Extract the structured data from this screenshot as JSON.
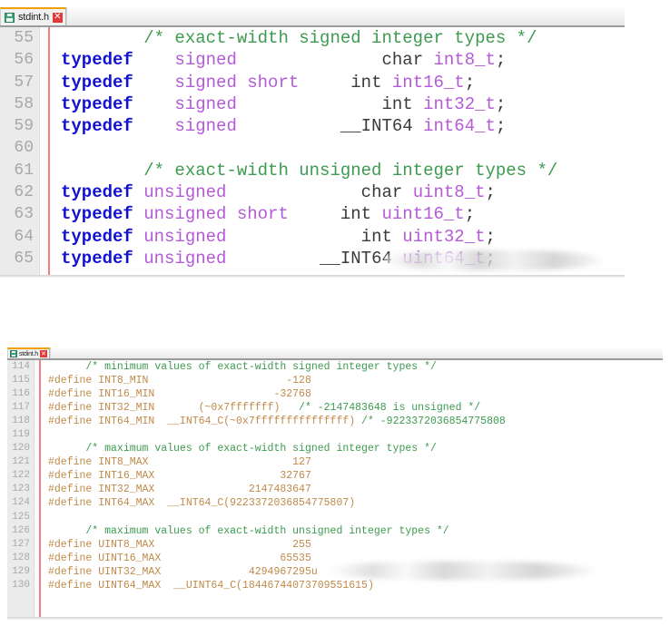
{
  "editors": [
    {
      "name": "editor-top",
      "tab": {
        "label": "stdint.h",
        "save_icon": "disk-icon",
        "close_icon": "close-icon",
        "close_glyph": "✕",
        "modified_accent": "#f0a000"
      },
      "first_line_number": 55,
      "line_numbers": [
        "55",
        "56",
        "57",
        "58",
        "59",
        "60",
        "61",
        "62",
        "63",
        "64",
        "65"
      ],
      "lines": [
        {
          "n": "55",
          "segments": [
            {
              "t": "com",
              "s": "        /* exact-width signed integer types */"
            }
          ]
        },
        {
          "n": "56",
          "segments": [
            {
              "t": "kw",
              "s": "typedef"
            },
            {
              "t": "typ",
              "s": "    signed"
            },
            {
              "t": "pln",
              "s": "              char "
            },
            {
              "t": "typ",
              "s": "int8_t"
            },
            {
              "t": "pln",
              "s": ";"
            }
          ]
        },
        {
          "n": "57",
          "segments": [
            {
              "t": "kw",
              "s": "typedef"
            },
            {
              "t": "typ",
              "s": "    signed short"
            },
            {
              "t": "pln",
              "s": "     int "
            },
            {
              "t": "typ",
              "s": "int16_t"
            },
            {
              "t": "pln",
              "s": ";"
            }
          ]
        },
        {
          "n": "58",
          "segments": [
            {
              "t": "kw",
              "s": "typedef"
            },
            {
              "t": "typ",
              "s": "    signed"
            },
            {
              "t": "pln",
              "s": "              int "
            },
            {
              "t": "typ",
              "s": "int32_t"
            },
            {
              "t": "pln",
              "s": ";"
            }
          ]
        },
        {
          "n": "59",
          "segments": [
            {
              "t": "kw",
              "s": "typedef"
            },
            {
              "t": "typ",
              "s": "    signed"
            },
            {
              "t": "pln",
              "s": "          __INT64 "
            },
            {
              "t": "typ",
              "s": "int64_t"
            },
            {
              "t": "pln",
              "s": ";"
            }
          ]
        },
        {
          "n": "60",
          "segments": [
            {
              "t": "pln",
              "s": ""
            }
          ]
        },
        {
          "n": "61",
          "segments": [
            {
              "t": "com",
              "s": "        /* exact-width unsigned integer types */"
            }
          ]
        },
        {
          "n": "62",
          "segments": [
            {
              "t": "kw",
              "s": "typedef"
            },
            {
              "t": "typ",
              "s": " unsigned"
            },
            {
              "t": "pln",
              "s": "             char "
            },
            {
              "t": "typ",
              "s": "uint8_t"
            },
            {
              "t": "pln",
              "s": ";"
            }
          ]
        },
        {
          "n": "63",
          "segments": [
            {
              "t": "kw",
              "s": "typedef"
            },
            {
              "t": "typ",
              "s": " unsigned short"
            },
            {
              "t": "pln",
              "s": "     int "
            },
            {
              "t": "typ",
              "s": "uint16_t"
            },
            {
              "t": "pln",
              "s": ";"
            }
          ]
        },
        {
          "n": "64",
          "segments": [
            {
              "t": "kw",
              "s": "typedef"
            },
            {
              "t": "typ",
              "s": " unsigned"
            },
            {
              "t": "pln",
              "s": "             int "
            },
            {
              "t": "typ",
              "s": "uint32_t"
            },
            {
              "t": "pln",
              "s": ";"
            }
          ]
        },
        {
          "n": "65",
          "segments": [
            {
              "t": "kw",
              "s": "typedef"
            },
            {
              "t": "typ",
              "s": " unsigned"
            },
            {
              "t": "pln",
              "s": "         __INT64 "
            },
            {
              "t": "typ",
              "s": "uint64_t"
            },
            {
              "t": "pln",
              "s": ";"
            }
          ]
        }
      ]
    },
    {
      "name": "editor-bottom",
      "tab": {
        "label": "stdint.h",
        "save_icon": "disk-icon",
        "close_icon": "close-icon",
        "close_glyph": "✕",
        "modified_accent": "#f0a000"
      },
      "first_line_number": 114,
      "line_numbers": [
        "114",
        "115",
        "116",
        "117",
        "118",
        "119",
        "120",
        "121",
        "122",
        "123",
        "124",
        "125",
        "126",
        "127",
        "128",
        "129",
        "130"
      ],
      "lines": [
        {
          "n": "114",
          "segments": [
            {
              "t": "com",
              "s": "      /* minimum values of exact-width signed integer types */"
            }
          ]
        },
        {
          "n": "115",
          "segments": [
            {
              "t": "pre",
              "s": "#define INT8_MIN                      -128"
            }
          ]
        },
        {
          "n": "116",
          "segments": [
            {
              "t": "pre",
              "s": "#define INT16_MIN                   -32768"
            }
          ]
        },
        {
          "n": "117",
          "segments": [
            {
              "t": "pre",
              "s": "#define INT32_MIN       (~0x7fffffff)"
            },
            {
              "t": "com",
              "s": "   /* -2147483648 is unsigned */"
            }
          ]
        },
        {
          "n": "118",
          "segments": [
            {
              "t": "pre",
              "s": "#define INT64_MIN  __INT64_C(~0x7fffffffffffffff)"
            },
            {
              "t": "com",
              "s": " /* -9223372036854775808"
            }
          ]
        },
        {
          "n": "119",
          "segments": [
            {
              "t": "pln",
              "s": ""
            }
          ]
        },
        {
          "n": "120",
          "segments": [
            {
              "t": "com",
              "s": "      /* maximum values of exact-width signed integer types */"
            }
          ]
        },
        {
          "n": "121",
          "segments": [
            {
              "t": "pre",
              "s": "#define INT8_MAX                       127"
            }
          ]
        },
        {
          "n": "122",
          "segments": [
            {
              "t": "pre",
              "s": "#define INT16_MAX                    32767"
            }
          ]
        },
        {
          "n": "123",
          "segments": [
            {
              "t": "pre",
              "s": "#define INT32_MAX               2147483647"
            }
          ]
        },
        {
          "n": "124",
          "segments": [
            {
              "t": "pre",
              "s": "#define INT64_MAX  __INT64_C(9223372036854775807)"
            }
          ]
        },
        {
          "n": "125",
          "segments": [
            {
              "t": "pln",
              "s": ""
            }
          ]
        },
        {
          "n": "126",
          "segments": [
            {
              "t": "com",
              "s": "      /* maximum values of exact-width unsigned integer types */"
            }
          ]
        },
        {
          "n": "127",
          "segments": [
            {
              "t": "pre",
              "s": "#define UINT8_MAX                      255"
            }
          ]
        },
        {
          "n": "128",
          "segments": [
            {
              "t": "pre",
              "s": "#define UINT16_MAX                   65535"
            }
          ]
        },
        {
          "n": "129",
          "segments": [
            {
              "t": "pre",
              "s": "#define UINT32_MAX              4294967295u"
            }
          ]
        },
        {
          "n": "130",
          "segments": [
            {
              "t": "pre",
              "s": "#define UINT64_MAX  __UINT64_C(18446744073709551615)"
            }
          ]
        }
      ]
    }
  ],
  "watermarks": [
    {
      "name": "watermark-top",
      "obscured": true
    },
    {
      "name": "watermark-bottom",
      "obscured": true
    }
  ],
  "colors": {
    "comment": "#3d9b4f",
    "keyword": "#1212d0",
    "type": "#b45ad8",
    "plain": "#3a3a3a",
    "preprocessor": "#c08a4a",
    "gutter_bg": "#ebebeb",
    "gutter_fg": "#a8a8a8",
    "tab_accent": "#f0a000",
    "close_bg": "#e03a3a",
    "fold_marker": "#f08080",
    "editor_bg": "#ffffff"
  }
}
